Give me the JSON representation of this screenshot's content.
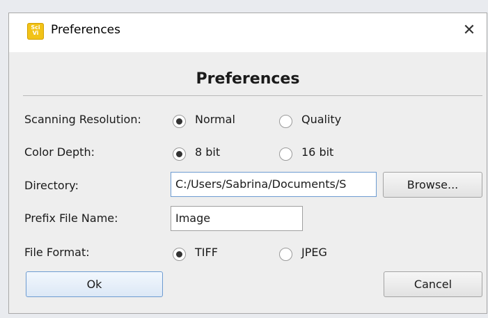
{
  "window": {
    "title": "Preferences",
    "app_icon_text_top": "Sci",
    "app_icon_text_bottom": "Vi",
    "close_glyph": "✕"
  },
  "heading": "Preferences",
  "form": {
    "scanning_resolution": {
      "label": "Scanning Resolution:",
      "options": [
        "Normal",
        "Quality"
      ],
      "selected": "Normal"
    },
    "color_depth": {
      "label": "Color Depth:",
      "options": [
        "8 bit",
        "16 bit"
      ],
      "selected": "8 bit"
    },
    "directory": {
      "label": "Directory:",
      "value": "C:/Users/Sabrina/Documents/S",
      "browse_label": "Browse..."
    },
    "prefix_file_name": {
      "label": "Prefix File Name:",
      "value": "Image"
    },
    "file_format": {
      "label": "File Format:",
      "options": [
        "TIFF",
        "JPEG"
      ],
      "selected": "TIFF"
    }
  },
  "buttons": {
    "ok": "Ok",
    "cancel": "Cancel"
  },
  "colors": {
    "app_icon": "#f2c318",
    "focus_border": "#6d9bd1"
  },
  "icons": {
    "app": "sciview-app-icon",
    "close": "close-icon"
  }
}
